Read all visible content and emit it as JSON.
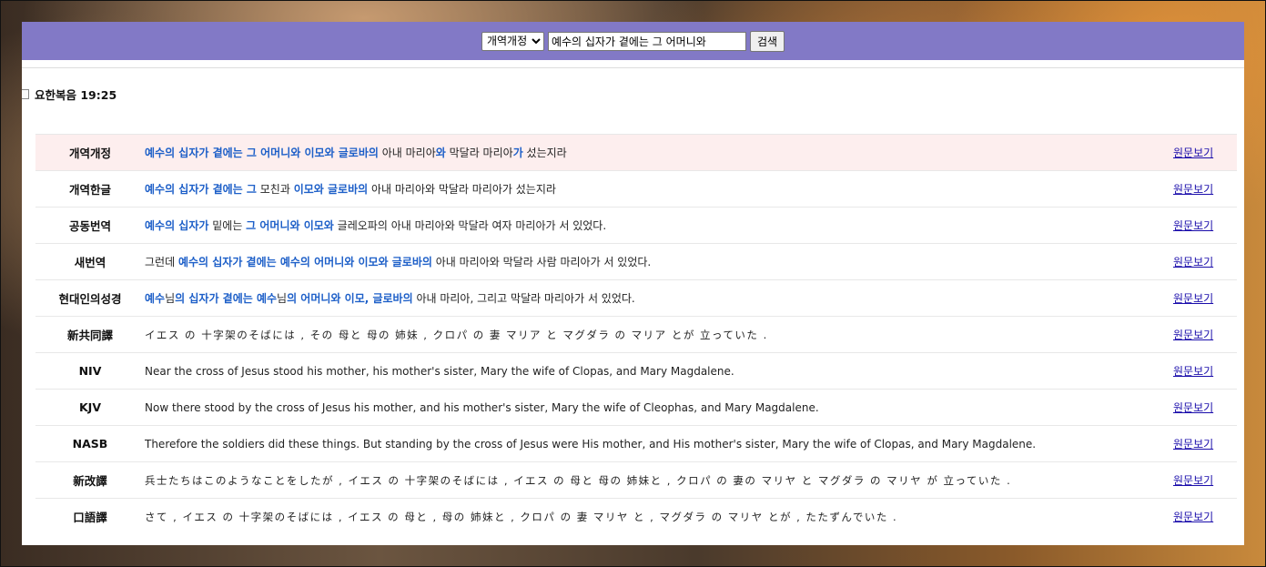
{
  "search": {
    "version_selected": "개역개정",
    "query_value": "예수의 십자가 곁에는 그 어머니와",
    "button_label": "검색"
  },
  "reference": "요한복음 19:25",
  "link_label": "원문보기",
  "rows": [
    {
      "version": "개역개정",
      "highlight": true,
      "jp": false,
      "segments": [
        {
          "t": "예수의 십자가 곁에는 그 어머니와 이모와 글로바의",
          "m": true
        },
        {
          "t": " 아내 마리아",
          "m": false
        },
        {
          "t": "와",
          "m": true
        },
        {
          "t": " 막달라 마리아",
          "m": false
        },
        {
          "t": "가",
          "m": true
        },
        {
          "t": " 섰는지라",
          "m": false
        }
      ]
    },
    {
      "version": "개역한글",
      "highlight": false,
      "jp": false,
      "segments": [
        {
          "t": "예수의 십자가 곁에는 그",
          "m": true
        },
        {
          "t": " 모친과 ",
          "m": false
        },
        {
          "t": "이모와 글로바의",
          "m": true
        },
        {
          "t": " 아내 마리아와 막달라 마리아가 섰는지라",
          "m": false
        }
      ]
    },
    {
      "version": "공동번역",
      "highlight": false,
      "jp": false,
      "segments": [
        {
          "t": "예수의 십자가",
          "m": true
        },
        {
          "t": " 밑에는 ",
          "m": false
        },
        {
          "t": "그 어머니와 이모와",
          "m": true
        },
        {
          "t": " 글레오파의 아내 마리아와 막달라 여자 마리아가 서 있었다.",
          "m": false
        }
      ]
    },
    {
      "version": "새번역",
      "highlight": false,
      "jp": false,
      "segments": [
        {
          "t": "그런데 ",
          "m": false
        },
        {
          "t": "예수의 십자가 곁에는 예수의 어머니와 이모와 글로바의",
          "m": true
        },
        {
          "t": " 아내 마리아와 막달라 사람 마리아가 서 있었다.",
          "m": false
        }
      ]
    },
    {
      "version": "현대인의성경",
      "highlight": false,
      "jp": false,
      "segments": [
        {
          "t": "예수",
          "m": true
        },
        {
          "t": "님",
          "m": false
        },
        {
          "t": "의 십자가 곁에는 예수",
          "m": true
        },
        {
          "t": "님",
          "m": false
        },
        {
          "t": "의 어머니와 이모, 글로바의",
          "m": true
        },
        {
          "t": " 아내 마리아, 그리고 막달라 마리아가 서 있었다.",
          "m": false
        }
      ]
    },
    {
      "version": "新共同譯",
      "highlight": false,
      "jp": true,
      "segments": [
        {
          "t": "イエス の 十字架のそばには , その 母と 母の 姉妹 , クロパ の 妻 マリア と マグダラ の マリア とが 立っていた .",
          "m": false
        }
      ]
    },
    {
      "version": "NIV",
      "highlight": false,
      "jp": false,
      "segments": [
        {
          "t": "Near the cross of Jesus stood his mother, his mother's sister, Mary the wife of Clopas, and Mary Magdalene.",
          "m": false
        }
      ]
    },
    {
      "version": "KJV",
      "highlight": false,
      "jp": false,
      "segments": [
        {
          "t": "Now there stood by the cross of Jesus his mother, and his mother's sister, Mary the wife of Cleophas, and Mary Magdalene.",
          "m": false
        }
      ]
    },
    {
      "version": "NASB",
      "highlight": false,
      "jp": false,
      "segments": [
        {
          "t": "Therefore the soldiers did these things. But standing by the cross of Jesus were His mother, and His mother's sister, Mary the wife of Clopas, and Mary Magdalene.",
          "m": false
        }
      ]
    },
    {
      "version": "新改譯",
      "highlight": false,
      "jp": true,
      "segments": [
        {
          "t": "兵士たちはこのようなことをしたが , イエス の 十字架のそばには , イエス の 母と 母の 姉妹と , クロパ の 妻の マリヤ と マグダラ の マリヤ が 立っていた .",
          "m": false
        }
      ]
    },
    {
      "version": "口語譯",
      "highlight": false,
      "jp": true,
      "segments": [
        {
          "t": "さて , イエス の 十字架のそばには , イエス の 母と , 母の 姉妹と , クロパ の 妻 マリヤ と , マグダラ の マリヤ とが , たたずんでいた .",
          "m": false
        }
      ]
    }
  ]
}
